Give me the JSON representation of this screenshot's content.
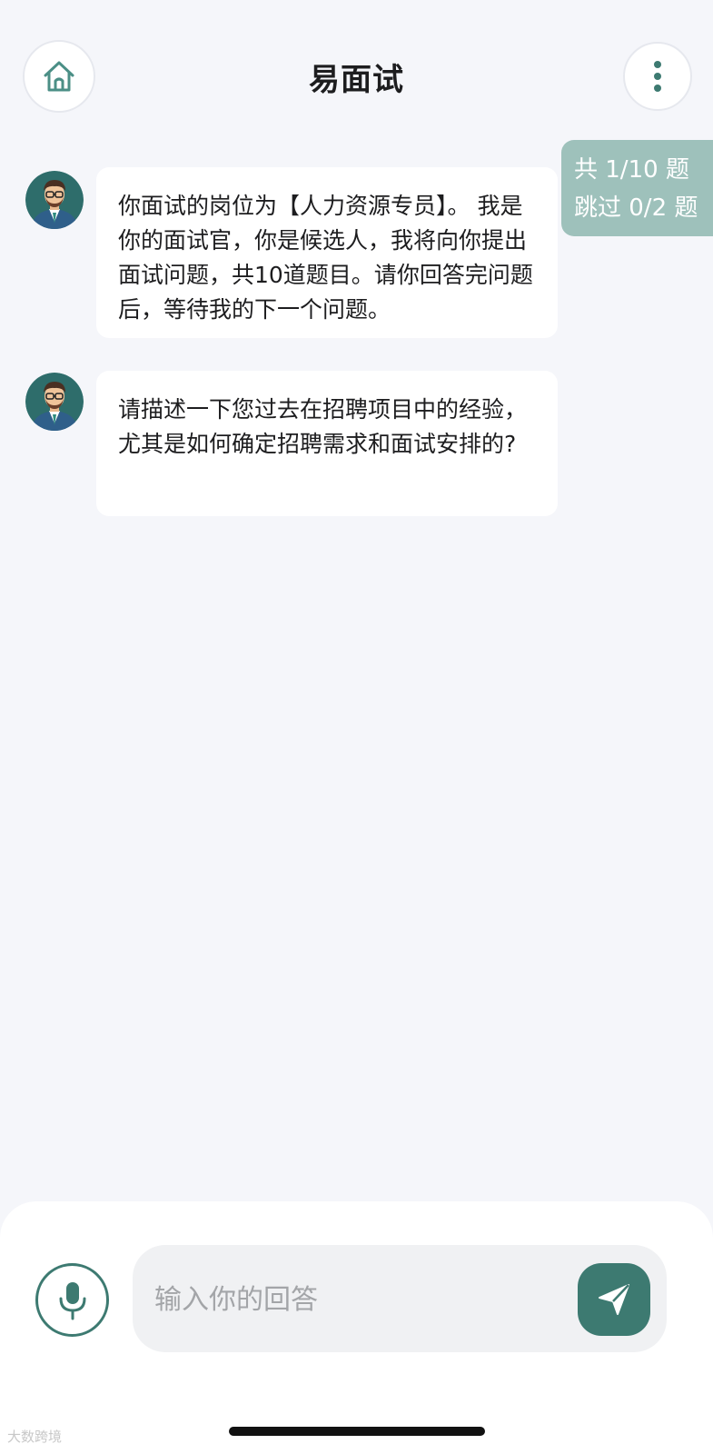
{
  "header": {
    "title": "易面试",
    "home_icon": "home-icon",
    "menu_icon": "more-vertical-icon"
  },
  "progress": {
    "questions": "共 1/10 题",
    "skipped": "跳过 0/2 题",
    "color": "#9ec1bb"
  },
  "messages": [
    {
      "sender": "interviewer",
      "text": "你面试的岗位为【人力资源专员】。 我是你的面试官，你是候选人，我将向你提出面试问题，共10道题目。请你回答完问题后，等待我的下一个问题。"
    },
    {
      "sender": "interviewer",
      "text": "请描述一下您过去在招聘项目中的经验，尤其是如何确定招聘需求和面试安排的?"
    }
  ],
  "composer": {
    "placeholder": "输入你的回答",
    "mic_icon": "microphone-icon",
    "send_icon": "send-icon",
    "accent_color": "#3d7a71"
  },
  "watermark": "大数跨境"
}
